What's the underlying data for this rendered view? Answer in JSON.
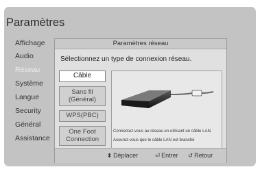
{
  "screen": {
    "title": "Paramètres"
  },
  "sidebar": {
    "items": [
      {
        "label": "Affichage"
      },
      {
        "label": "Audio"
      },
      {
        "label": "Réseau",
        "active": true
      },
      {
        "label": "Système"
      },
      {
        "label": "Langue"
      },
      {
        "label": "Security"
      },
      {
        "label": "Général"
      },
      {
        "label": "Assistance"
      }
    ]
  },
  "dialog": {
    "title": "Paramètres réseau",
    "prompt": "Sélectionnez un type de connexion  réseau.",
    "options": [
      {
        "label": "Câble",
        "selected": true
      },
      {
        "label": "Sans fil (Général)"
      },
      {
        "label": "WPS(PBC)"
      },
      {
        "label": "One Foot Connection"
      }
    ],
    "info": {
      "line1": "Connectez-vous au réseau en utilisant un câble LAN.",
      "line2": "Assurez-vous que le câble LAN est branché"
    },
    "footer": {
      "move": {
        "symbol": "⬍",
        "label": "Déplacer"
      },
      "enter": {
        "symbol": "⏎",
        "label": "Entrer"
      },
      "back": {
        "symbol": "↺",
        "label": "Retour"
      }
    }
  },
  "icons": {
    "device": "bluray-player-icon",
    "cable": "lan-cable-icon"
  },
  "colors": {
    "screen_bg": "#c3c3c3",
    "dialog_bg": "#e0e0e0",
    "selected_bg": "#ffffff"
  }
}
